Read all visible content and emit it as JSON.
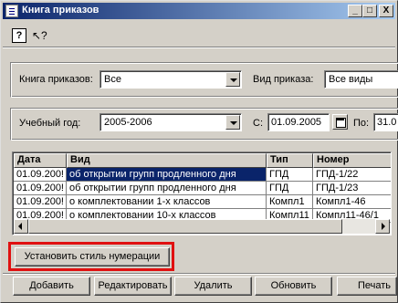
{
  "window": {
    "title": "Книга приказов",
    "controls": {
      "minimize": "_",
      "maximize": "□",
      "close": "X"
    }
  },
  "toolbar": {
    "help_glyph": "?",
    "whatsthis_glyph": "↖?"
  },
  "filters": {
    "book_label": "Книга приказов:",
    "book_value": "Все",
    "type_label": "Вид приказа:",
    "type_value": "Все виды",
    "year_label": "Учебный год:",
    "year_value": "2005-2006",
    "from_label": "С:",
    "from_value": "01.09.2005",
    "to_label": "По:",
    "to_value": "31.0"
  },
  "grid": {
    "columns": [
      "Дата",
      "Вид",
      "Тип",
      "Номер"
    ],
    "rows": [
      [
        "01.09.200!",
        "об открытии групп продленного дня",
        "ГПД",
        "ГПД-1/22"
      ],
      [
        "01.09.200!",
        "об открытии групп продленного дня",
        "ГПД",
        "ГПД-1/23"
      ],
      [
        "01.09.200!",
        "о комплектовании 1-х классов",
        "Компл1",
        "Компл1-46"
      ],
      [
        "01.09.200!",
        "о комплектовании 10-х классов",
        "Компл11",
        "Компл11-46/1"
      ]
    ]
  },
  "buttons": {
    "numbering_style": "Установить стиль нумерации",
    "add": "Добавить",
    "edit": "Редактировать",
    "delete": "Удалить",
    "refresh": "Обновить",
    "print": "Печать"
  },
  "colors": {
    "title_gradient_start": "#0a246a",
    "title_gradient_end": "#a6caf0",
    "face": "#d4d0c8",
    "highlight_box": "#e01010"
  }
}
